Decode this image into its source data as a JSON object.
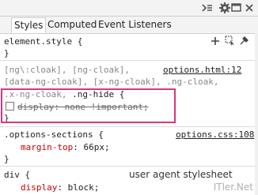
{
  "tabs": {
    "styles": "Styles",
    "computed": "Computed",
    "event_listeners": "Event Listeners"
  },
  "sections": {
    "element_style": {
      "selector": "element.style {",
      "close": "}"
    },
    "ng_cloak": {
      "selector_line1": "[ng\\:cloak], [ng-cloak],",
      "selector_line2": "[data-ng-cloak], [x-ng-cloak], .ng-cloak,",
      "selector_line3a": ".x-ng-cloak,",
      "selector_line3b": ".ng-hide {",
      "source": "options.html:12",
      "prop_name": "display",
      "prop_value": "none !important;",
      "close": "}"
    },
    "options_sections": {
      "selector": ".options-sections {",
      "source": "options.css:108",
      "prop_name": "margin-top",
      "prop_value": "66px;",
      "close": "}"
    },
    "div": {
      "selector": "div {",
      "source": "user agent stylesheet",
      "prop_name": "display",
      "prop_value": "block;"
    }
  },
  "watermark": "ITler.Net",
  "colors": {
    "highlight_border": "#d9367f",
    "property_name": "#c80000"
  }
}
